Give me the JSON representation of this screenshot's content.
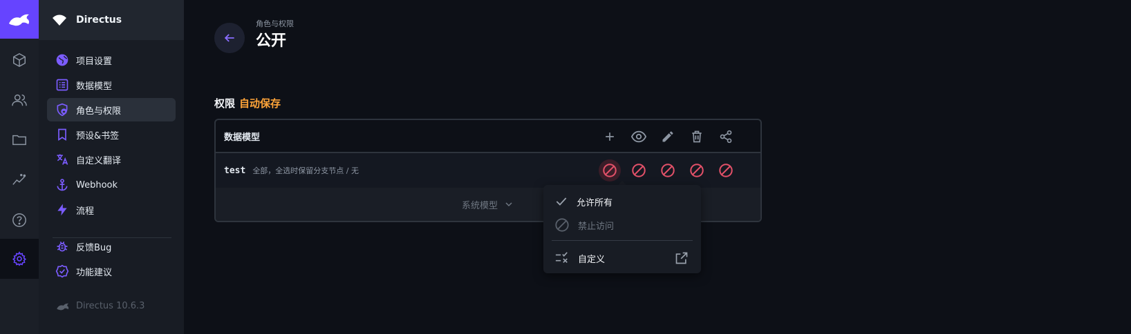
{
  "app": {
    "project_name": "Directus",
    "version": "Directus 10.6.3"
  },
  "module_bar": {
    "items": [
      {
        "name": "content",
        "icon": "box-icon"
      },
      {
        "name": "users",
        "icon": "users-icon"
      },
      {
        "name": "files",
        "icon": "folder-icon"
      },
      {
        "name": "insights",
        "icon": "insights-icon"
      },
      {
        "name": "help",
        "icon": "help-icon"
      },
      {
        "name": "settings",
        "icon": "gear-icon",
        "active": true
      }
    ]
  },
  "nav": {
    "items": [
      {
        "label": "项目设置",
        "icon": "globe-icon"
      },
      {
        "label": "数据模型",
        "icon": "list-icon"
      },
      {
        "label": "角色与权限",
        "icon": "shield-icon",
        "active": true
      },
      {
        "label": "预设&书签",
        "icon": "bookmark-icon"
      },
      {
        "label": "自定义翻译",
        "icon": "translate-icon"
      },
      {
        "label": "Webhook",
        "icon": "anchor-icon"
      },
      {
        "label": "流程",
        "icon": "bolt-icon"
      }
    ],
    "secondary": [
      {
        "label": "反馈Bug",
        "icon": "bug-icon"
      },
      {
        "label": "功能建议",
        "icon": "verified-icon"
      }
    ]
  },
  "header": {
    "breadcrumb": "角色与权限",
    "title": "公开"
  },
  "permissions": {
    "label": "权限",
    "autosave": "自动保存",
    "header_label": "数据模型",
    "header_icons": [
      "add-icon",
      "eye-icon",
      "edit-icon",
      "delete-icon",
      "share-icon"
    ],
    "rows": [
      {
        "collection": "test",
        "note": "全部，全选时保留分支节点 / 无"
      }
    ],
    "system_label": "系统模型"
  },
  "menu": {
    "allow_all": "允许所有",
    "no_access": "禁止访问",
    "custom": "自定义"
  },
  "colors": {
    "accent": "#6644ff",
    "danger": "#e35169",
    "warning": "#ffa439"
  }
}
